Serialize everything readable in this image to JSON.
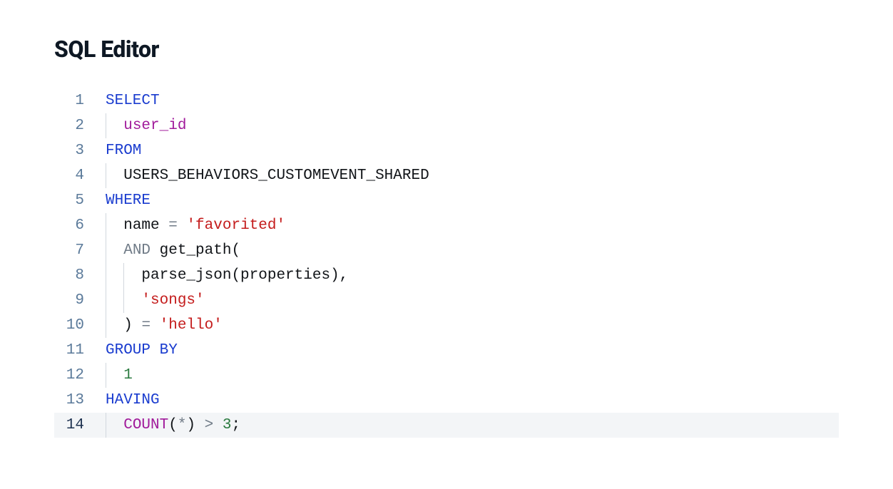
{
  "title": "SQL Editor",
  "editor": {
    "highlightLine": 14,
    "lines": [
      {
        "num": "1",
        "indent": 0,
        "guides": [],
        "tokens": [
          {
            "cls": "kw",
            "text": "SELECT"
          }
        ]
      },
      {
        "num": "2",
        "indent": 1,
        "guides": [
          0
        ],
        "tokens": [
          {
            "cls": "ident",
            "text": "user_id"
          }
        ]
      },
      {
        "num": "3",
        "indent": 0,
        "guides": [],
        "tokens": [
          {
            "cls": "kw",
            "text": "FROM"
          }
        ]
      },
      {
        "num": "4",
        "indent": 1,
        "guides": [
          0
        ],
        "tokens": [
          {
            "cls": "txt",
            "text": "USERS_BEHAVIORS_CUSTOMEVENT_SHARED"
          }
        ]
      },
      {
        "num": "5",
        "indent": 0,
        "guides": [],
        "tokens": [
          {
            "cls": "kw",
            "text": "WHERE"
          }
        ]
      },
      {
        "num": "6",
        "indent": 1,
        "guides": [
          0
        ],
        "tokens": [
          {
            "cls": "txt",
            "text": "name "
          },
          {
            "cls": "op",
            "text": "="
          },
          {
            "cls": "txt",
            "text": " "
          },
          {
            "cls": "str",
            "text": "'favorited'"
          }
        ]
      },
      {
        "num": "7",
        "indent": 1,
        "guides": [
          0
        ],
        "tokens": [
          {
            "cls": "op",
            "text": "AND"
          },
          {
            "cls": "txt",
            "text": " get_path("
          }
        ]
      },
      {
        "num": "8",
        "indent": 2,
        "guides": [
          0,
          1
        ],
        "tokens": [
          {
            "cls": "txt",
            "text": "parse_json(properties),"
          }
        ]
      },
      {
        "num": "9",
        "indent": 2,
        "guides": [
          0,
          1
        ],
        "tokens": [
          {
            "cls": "str",
            "text": "'songs'"
          }
        ]
      },
      {
        "num": "10",
        "indent": 1,
        "guides": [
          0
        ],
        "tokens": [
          {
            "cls": "txt",
            "text": ") "
          },
          {
            "cls": "op",
            "text": "="
          },
          {
            "cls": "txt",
            "text": " "
          },
          {
            "cls": "str",
            "text": "'hello'"
          }
        ]
      },
      {
        "num": "11",
        "indent": 0,
        "guides": [],
        "tokens": [
          {
            "cls": "kw",
            "text": "GROUP BY"
          }
        ]
      },
      {
        "num": "12",
        "indent": 1,
        "guides": [
          0
        ],
        "tokens": [
          {
            "cls": "num",
            "text": "1"
          }
        ]
      },
      {
        "num": "13",
        "indent": 0,
        "guides": [],
        "tokens": [
          {
            "cls": "kw",
            "text": "HAVING"
          }
        ]
      },
      {
        "num": "14",
        "indent": 1,
        "guides": [
          0
        ],
        "tokens": [
          {
            "cls": "func",
            "text": "COUNT"
          },
          {
            "cls": "txt",
            "text": "("
          },
          {
            "cls": "star",
            "text": "*"
          },
          {
            "cls": "txt",
            "text": ") "
          },
          {
            "cls": "op",
            "text": ">"
          },
          {
            "cls": "txt",
            "text": " "
          },
          {
            "cls": "num",
            "text": "3"
          },
          {
            "cls": "txt",
            "text": ";"
          }
        ]
      }
    ]
  }
}
